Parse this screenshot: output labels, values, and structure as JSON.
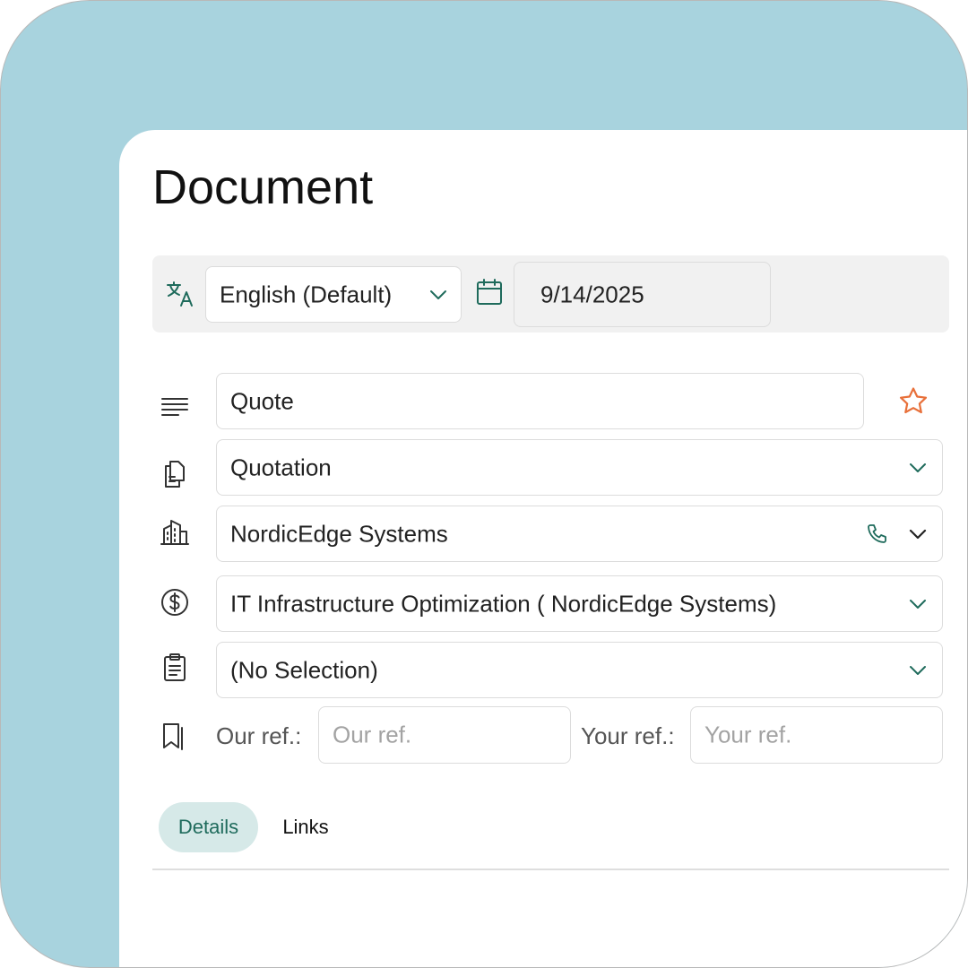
{
  "page": {
    "title": "Document"
  },
  "toolbar": {
    "language_value": "English (Default)",
    "date_value": "9/14/2025"
  },
  "form": {
    "name_value": "Quote",
    "type_value": "Quotation",
    "company_value": "NordicEdge Systems",
    "project_value": "IT Infrastructure Optimization ( NordicEdge Systems)",
    "template_value": "(No Selection)",
    "our_ref_label": "Our ref.:",
    "our_ref_placeholder": "Our ref.",
    "your_ref_label": "Your ref.:",
    "your_ref_placeholder": "Your ref."
  },
  "tabs": [
    {
      "label": "Details",
      "active": true
    },
    {
      "label": "Links",
      "active": false
    }
  ],
  "colors": {
    "background": "#a8d3de",
    "accent": "#1f6b5c",
    "star": "#e8703a",
    "tab_active_bg": "#d6e9e8"
  }
}
